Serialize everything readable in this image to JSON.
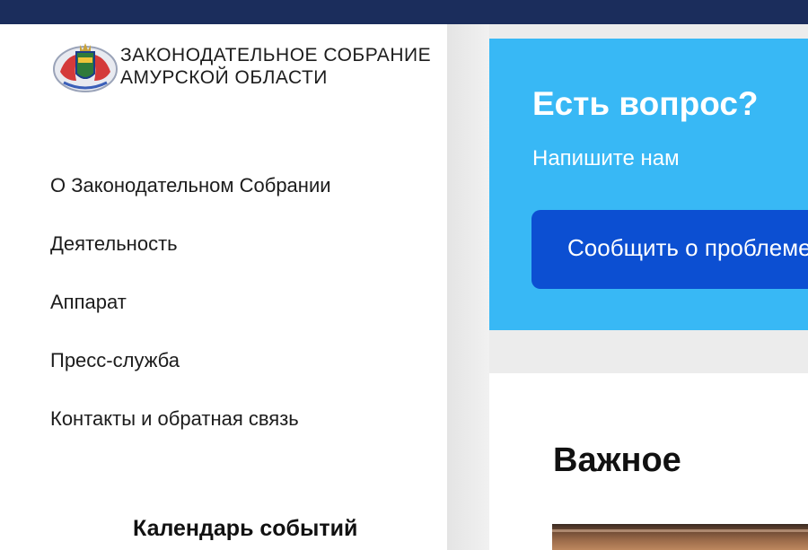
{
  "header": {
    "org_name_line1": "Законодательное Собрание",
    "org_name_line2": "Амурской области",
    "logo_icon": "coat-of-arms-emblem"
  },
  "nav": {
    "items": [
      {
        "label": "О Законодательном Собрании"
      },
      {
        "label": "Деятельность"
      },
      {
        "label": "Аппарат"
      },
      {
        "label": "Пресс-служба"
      },
      {
        "label": "Контакты и обратная связь"
      }
    ]
  },
  "calendar": {
    "title": "Календарь событий"
  },
  "question": {
    "title": "Есть вопрос?",
    "subtitle": "Напишите нам",
    "button_label": "Сообщить о проблеме"
  },
  "news": {
    "title": "Важное"
  },
  "colors": {
    "topbar": "#1b2d5c",
    "question_bg": "#38b8f5",
    "button_bg": "#0c4fd2"
  }
}
